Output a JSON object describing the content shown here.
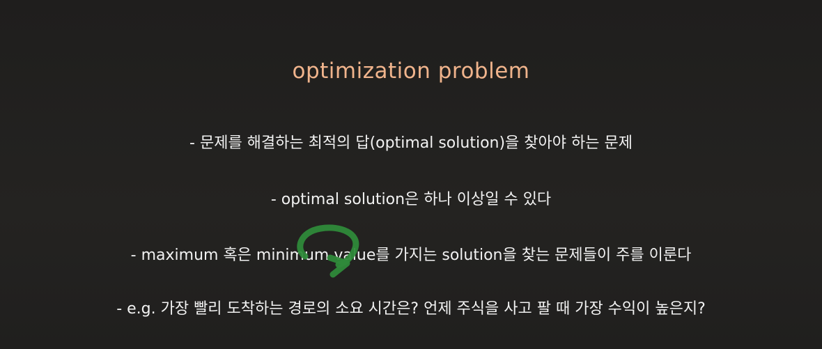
{
  "title": "optimization problem",
  "bullets": [
    "- 문제를 해결하는 최적의 답(optimal solution)을 찾아야 하는 문제",
    "- optimal solution은 하나 이상일 수 있다",
    "- maximum 혹은 minimum value를 가지는 solution을 찾는 문제들이 주를 이룬다",
    "- e.g. 가장 빨리 도착하는 경로의 소요 시간은? 언제 주식을 사고 팔 때 가장 수익이 높은지?"
  ],
  "colors": {
    "background": "#222120",
    "title": "#f0b48c",
    "text": "#f2f2f2",
    "annotation": "#2f8a3a"
  },
  "annotation": {
    "icon": "green-hand-drawn-circle-arrow-icon"
  }
}
